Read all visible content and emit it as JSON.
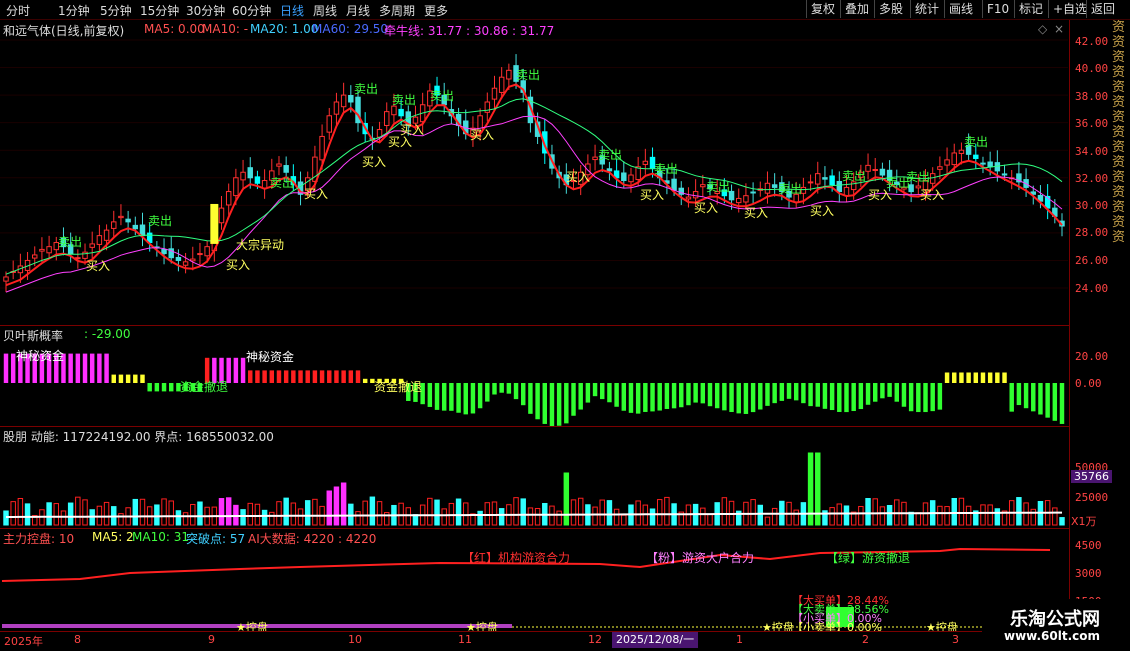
{
  "toolbar": {
    "periods": [
      "分时",
      "1分钟",
      "5分钟",
      "15分钟",
      "30分钟",
      "60分钟",
      "日线",
      "周线",
      "月线",
      "多周期",
      "更多"
    ],
    "active_period": "日线",
    "right_buttons": [
      "复权",
      "叠加",
      "多股",
      "统计",
      "画线",
      "F10",
      "标记",
      "+自选",
      "返回"
    ]
  },
  "main_panel": {
    "title": "和远气体(日线,前复权)",
    "ma5": "MA5: 0.00",
    "ma10": "MA10: -",
    "ma20": "MA20: 1.00",
    "ma60": "MA60: 29.50",
    "qianniu": "牵牛线: 31.77 : 30.86 : 31.77",
    "y_ticks": [
      "42.00",
      "40.00",
      "38.00",
      "36.00",
      "34.00",
      "32.00",
      "30.00",
      "28.00",
      "26.00",
      "24.00"
    ],
    "sell_label": "卖出",
    "buy_label": "买入",
    "event_label": "大宗异动"
  },
  "bayes_panel": {
    "title": "贝叶斯概率",
    "value": ": -29.00",
    "y_ticks": [
      "20.00",
      "0.00"
    ],
    "labels": [
      "神秘资金",
      "资金撤退",
      "神秘资金",
      "资金撤退"
    ]
  },
  "volume_panel": {
    "title": "股朋 动能: 117224192.00 界点: 168550032.00",
    "y_ticks": [
      "50000",
      "25000"
    ],
    "current": "35766",
    "unit": "X1万"
  },
  "control_panel": {
    "title": "主力控盘: 10",
    "ma5": "MA5: 2",
    "ma10": "MA10: 31",
    "break_point": "突破点: 57",
    "ai_data": "AI大数据: 4220 : 4220",
    "y_ticks": [
      "4500",
      "3000",
      "1500"
    ],
    "annot1": "【红】机构游资合力",
    "annot2": "【粉】游资大户合力",
    "annot3": "【绿】游资撤退",
    "orders": [
      "【大买单】28.44%",
      "【大卖单】28.56%",
      "【小买单】0.00%",
      "【小卖单】0.00%"
    ],
    "control_label": "控盘"
  },
  "date_axis": {
    "labels": [
      "2025年",
      "8",
      "9",
      "10",
      "11",
      "12",
      "1",
      "2",
      "3"
    ],
    "cursor_date": "2025/12/08/一"
  },
  "side_strip": "资资资资资资资资资资资资资资资",
  "watermark": {
    "site_name": "乐淘公式网",
    "url": "www.60lt.com"
  },
  "chart_data": {
    "type": "candlestick",
    "price_axis": [
      24,
      42
    ],
    "close_series": [
      24.8,
      25.2,
      25.6,
      26.0,
      26.4,
      26.8,
      27.0,
      27.3,
      27.0,
      26.5,
      26.2,
      26.6,
      27.2,
      27.8,
      28.2,
      28.8,
      29.2,
      28.8,
      28.3,
      27.8,
      27.3,
      26.9,
      26.5,
      26.2,
      26.0,
      25.9,
      26.1,
      26.5,
      27.0,
      28.5,
      29.8,
      31.0,
      32.0,
      32.4,
      32.0,
      31.6,
      31.8,
      32.5,
      33.0,
      32.4,
      31.5,
      30.8,
      32.0,
      33.5,
      35.0,
      36.5,
      37.5,
      38.0,
      37.5,
      36.0,
      35.2,
      34.8,
      35.5,
      36.8,
      37.2,
      36.5,
      35.8,
      36.4,
      37.3,
      38.3,
      38.0,
      37.3,
      36.5,
      35.8,
      35.2,
      35.6,
      36.5,
      37.5,
      38.5,
      39.3,
      39.8,
      39.0,
      38.2,
      36.0,
      35.0,
      33.8,
      32.7,
      32.0,
      31.5,
      31.8,
      32.4,
      33.0,
      33.5,
      33.0,
      32.5,
      32.0,
      31.8,
      32.2,
      32.8,
      33.2,
      32.7,
      32.0,
      31.6,
      31.1,
      30.8,
      30.6,
      31.0,
      31.5,
      31.2,
      31.0,
      30.7,
      30.4,
      30.5,
      30.7,
      30.9,
      31.2,
      31.6,
      31.3,
      31.0,
      30.6,
      30.8,
      31.3,
      31.7,
      32.3,
      31.9,
      31.5,
      31.0,
      31.3,
      31.7,
      32.4,
      32.9,
      32.6,
      32.2,
      31.8,
      31.5,
      31.3,
      31.0,
      31.4,
      31.8,
      32.3,
      32.8,
      33.3,
      33.8,
      34.0,
      33.7,
      33.4,
      33.0,
      32.8,
      32.5,
      32.2,
      32.0,
      31.7,
      31.3,
      30.8,
      30.3,
      29.8,
      29.2,
      28.5
    ]
  }
}
